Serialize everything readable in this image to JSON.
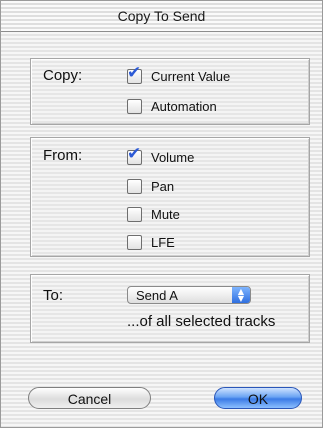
{
  "dialog": {
    "title": "Copy To Send"
  },
  "copy_group": {
    "label": "Copy:",
    "options": [
      {
        "label": "Current Value",
        "checked": true
      },
      {
        "label": "Automation",
        "checked": false
      }
    ]
  },
  "from_group": {
    "label": "From:",
    "options": [
      {
        "label": "Volume",
        "checked": true
      },
      {
        "label": "Pan",
        "checked": false
      },
      {
        "label": "Mute",
        "checked": false
      },
      {
        "label": "LFE",
        "checked": false
      }
    ]
  },
  "to_group": {
    "label": "To:",
    "selected_send": "Send A",
    "note": "...of all selected tracks"
  },
  "buttons": {
    "cancel_label": "Cancel",
    "ok_label": "OK"
  },
  "icons": {
    "checkmark": "✔",
    "popup_arrows_up": "▲",
    "popup_arrows_down": "▼"
  },
  "colors": {
    "default_button": "#3b7be6",
    "check_accent": "#2c5ad6"
  }
}
